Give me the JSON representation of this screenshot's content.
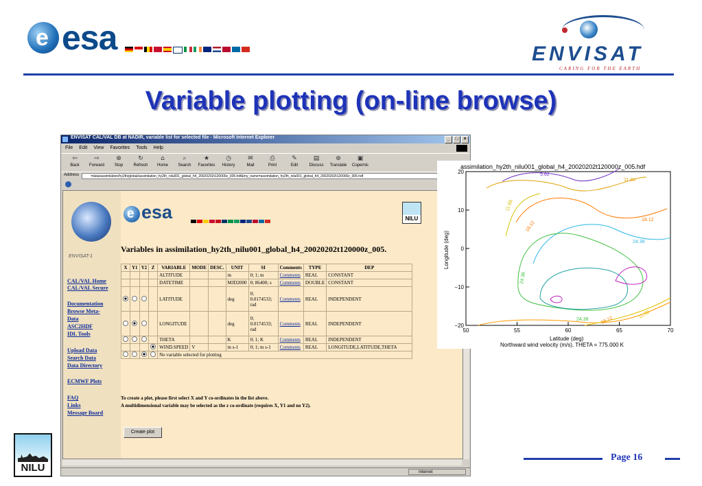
{
  "slide": {
    "esa_logo": "esa",
    "envisat_logo": "ENVISAT",
    "envisat_tagline": "CARING FOR THE EARTH",
    "title": "Variable plotting (on-line browse)",
    "page_label": "Page 16",
    "nilu_label": "NILU"
  },
  "browser": {
    "window_title": "ENVISAT CAL/VAL DB at NADIR, variable list for selected file - Microsoft Internet Explorer",
    "menu": [
      "File",
      "Edit",
      "View",
      "Favorites",
      "Tools",
      "Help"
    ],
    "toolbar": [
      "Back",
      "Forward",
      "Stop",
      "Refresh",
      "Home",
      "Search",
      "Favorites",
      "History",
      "Mail",
      "Print",
      "Edit",
      "Discuss",
      "Translate",
      "Copernic"
    ],
    "address_label": "Address",
    "address": "=data/assimilation/hy2th/global/assimilation_hy2th_nilu001_global_h4_20020202t120000z_005.hdf&my_name=assimilation_hy2th_nilu001_global_h4_20020202t120000z_005.hdf",
    "status_zone": "Internet"
  },
  "page": {
    "envisat_label": "ENVISAT-1",
    "esa": "esa",
    "nilu": "NILU",
    "heading": "Variables in assimilation_hy2th_nilu001_global_h4_20020202t120000z_005.",
    "side_links": [
      "CAL/VAL Home",
      "CAL/VAL Secure",
      "Documentation",
      "Browse Meta-",
      "Data",
      "ASC2HDF",
      "IDL Tools",
      "Upload Data",
      "Search Data",
      "Data Directory",
      "ECMWF Plots",
      "FAQ",
      "Links",
      "Message Board"
    ],
    "columns": [
      "X",
      "Y1",
      "Y2",
      "Z",
      "VARIABLE",
      "MODE",
      "DESC.",
      "UNIT",
      "SI",
      "Comments",
      "TYPE",
      "DEP"
    ],
    "rows": [
      {
        "variable": "ALTITUDE",
        "mode": "",
        "unit": "m",
        "si": "0; 1; m",
        "comments": "Comments",
        "type": "REAL",
        "dep": "CONSTANT"
      },
      {
        "variable": "DATETIME",
        "mode": "",
        "unit": "MJD2000",
        "si": "0; 86400; s",
        "comments": "Comments",
        "type": "DOUBLE",
        "dep": "CONSTANT"
      },
      {
        "variable": "LATITUDE",
        "mode": "",
        "unit": "deg",
        "si": "0; 0.0174533; rad",
        "comments": "Comments",
        "type": "REAL",
        "dep": "INDEPENDENT"
      },
      {
        "variable": "LONGITUDE",
        "mode": "",
        "unit": "deg",
        "si": "0; 0.0174533; rad",
        "comments": "Comments",
        "type": "REAL",
        "dep": "INDEPENDENT"
      },
      {
        "variable": "THETA",
        "mode": "",
        "unit": "K",
        "si": "0; 1; K",
        "comments": "Comments",
        "type": "REAL",
        "dep": "INDEPENDENT"
      },
      {
        "variable": "WIND.SPEED",
        "mode": "V",
        "unit": "m s-1",
        "si": "0; 1; m s-1",
        "comments": "Comments",
        "type": "REAL",
        "dep": "LONGITUDE,LATITUDE,THETA"
      }
    ],
    "no_var": "No variable selected for plotting",
    "instruction_1": "To create a plot, please first select X and Y co-ordinates in the list above.",
    "instruction_2": "A multidimensional variable may be selected as the z co-ordinate (requires X, Y1 and no Y2).",
    "create_plot": "Create plot"
  },
  "chart_data": {
    "type": "contour",
    "title": "assimilation_hy2th_nilu001_global_h4_20020202t120000z_005.hdf",
    "xlabel": "Latitude (deg)",
    "ylabel": "Longitude (deg)",
    "caption": "Northward wind velocity (m/s), THETA = 775.000 K",
    "xlim": [
      50,
      70
    ],
    "ylim": [
      -20,
      20
    ],
    "xticks": [
      50,
      55,
      60,
      65,
      70
    ],
    "yticks": [
      -20,
      -10,
      0,
      10,
      20
    ],
    "contour_labels": [
      "5.62",
      "11.88",
      "11.88",
      "18.12",
      "18.12",
      "24.38",
      "24.38",
      "24.38",
      "18.12",
      "11.88"
    ]
  }
}
